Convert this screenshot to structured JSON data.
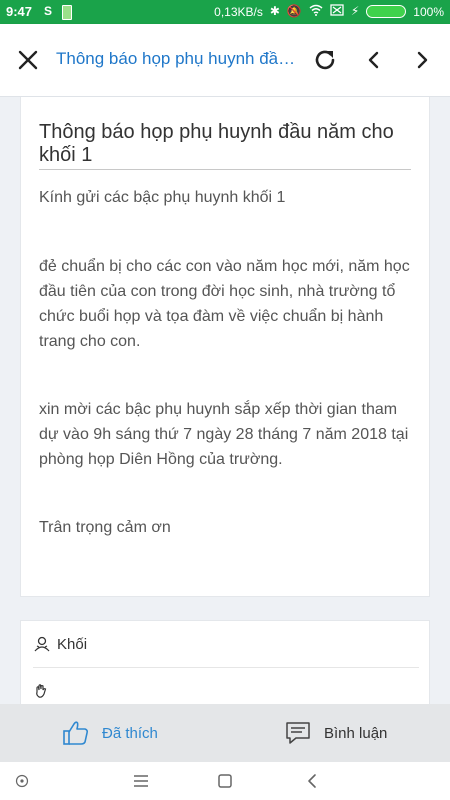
{
  "status": {
    "time": "9:47",
    "s_icon": "S",
    "network_speed": "0,13KB/s",
    "battery_percent": "100%"
  },
  "header": {
    "title": "Thông báo họp phụ huynh đầu ..."
  },
  "article": {
    "heading": "Thông báo họp phụ huynh đầu năm cho khối 1",
    "paragraphs": [
      "Kính gửi các bậc phụ huynh khối 1",
      "đẻ chuẩn bị cho các con vào năm học mới, năm học đầu tiên của con trong đời học sinh, nhà trường tổ chức buổi họp và tọa đàm về việc chuẩn bị hành trang cho con.",
      "xin mời các bậc phụ huynh sắp xếp thời gian tham dự vào 9h sáng thứ 7 ngày 28 tháng 7 năm 2018 tại phòng họp Diên Hồng của trường.",
      "Trân trọng cảm ơn"
    ]
  },
  "meta": {
    "group_label": "Khối",
    "second_label": ""
  },
  "actions": {
    "like_label": "Đã thích",
    "comment_label": "Bình luận"
  },
  "colors": {
    "status_bar": "#1aa34a",
    "accent": "#2f88d0",
    "title_blue": "#1f77c9"
  },
  "icons": [
    "close-icon",
    "refresh-icon",
    "chevron-left-icon",
    "chevron-right-icon",
    "group-icon",
    "hand-icon",
    "thumbs-up-icon",
    "comment-icon"
  ]
}
